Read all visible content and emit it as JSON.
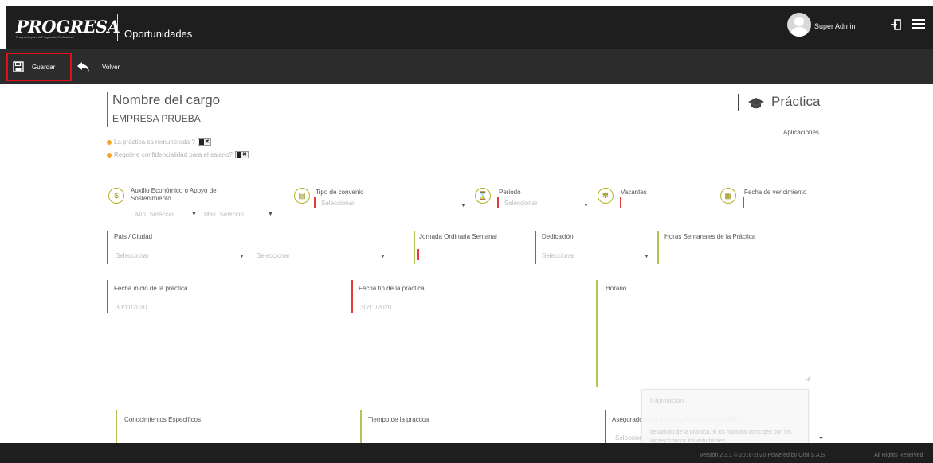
{
  "header": {
    "logo_text": "PROGRESA",
    "logo_tagline": "Programa para la Progresión Profesional",
    "module_title": "Oportunidades",
    "user_name": "Super Admin"
  },
  "toolbar": {
    "save_label": "Guardar",
    "back_label": "Volver"
  },
  "job": {
    "title": "Nombre del cargo",
    "company": "EMPRESA PRUEBA",
    "type": "Práctica",
    "applications_label": "Aplicaciones"
  },
  "questions": [
    {
      "label": "La práctica es remunerada ?",
      "toggle": "✖"
    },
    {
      "label": "Requiere confidencialidad para el salario?",
      "toggle": "✖"
    }
  ],
  "info_fields": {
    "auxilio_label": "Auxilio Económico o Apoyo de Sostenimiento",
    "auxilio_min": "Min. Seleccio",
    "auxilio_max": "Max. Seleccio",
    "convenio_label": "Tipo de convenio",
    "convenio_placeholder": "Seleccionar",
    "periodo_label": "Periodo",
    "periodo_placeholder": "Seleccionar",
    "vacantes_label": "Vacantes",
    "vencimiento_label": "Fecha de vencimiento"
  },
  "location": {
    "label": "País / Ciudad",
    "country_placeholder": "Seleccionar",
    "city_placeholder": "Seleccionar"
  },
  "jornada_label": "Jornada Ordinaria Semanal",
  "dedicacion": {
    "label": "Dedicación",
    "placeholder": "Seleccionar"
  },
  "horas_label": "Horas Semanales de la Práctica",
  "fecha_inicio": {
    "label": "Fecha inicio de la práctica",
    "value": "30/11/2020"
  },
  "fecha_fin": {
    "label": "Fecha fin de la práctica",
    "value": "30/11/2020"
  },
  "horario_label": "Horario",
  "conocimientos_label": "Conocimientos Específicos",
  "tiempo_label": "Tiempo de la práctica",
  "arl": {
    "label": "Aseguradora de Riesgos Profesionales (ARL)",
    "placeholder": "Seleccionar"
  },
  "info_popup": {
    "title": "Información",
    "text": "desarrollo de la práctica, si los horarios coinciden con los ingresos todos los estudiantes"
  },
  "footer": {
    "text": "Versión 2.3.1 © 2016-2020 Powered by Orbi S.A.S",
    "rights": "All Rights Reserved"
  }
}
